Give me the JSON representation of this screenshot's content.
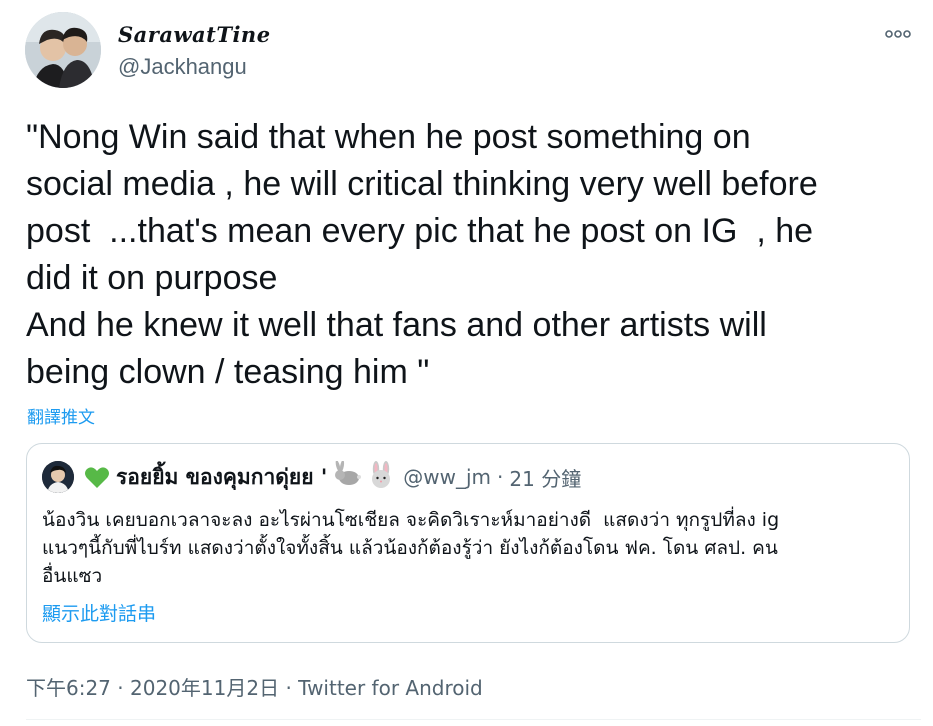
{
  "author": {
    "display_name": "SarawatTine",
    "handle": "@Jackhangu"
  },
  "tweet": {
    "text": "\"Nong Win said that when he post something on\nsocial media , he will critical thinking very well before\npost  ...that's mean every pic that he post on IG  , he\ndid it on purpose\nAnd he knew it well that fans and other artists will\nbeing clown / teasing him \"",
    "translate_label": "翻譯推文"
  },
  "quote": {
    "name": "รอยยิ้ม ของคุมกาดุ่ยย '",
    "handle": "@ww_jm",
    "separator": "·",
    "time": "21 分鐘",
    "text": "น้องวิน เคยบอกเวลาจะลง อะไรผ่านโซเชียล จะคิดวิเราะห์มาอย่างดี  แสดงว่า ทุกรูปที่ลง ig\nแนวๆนี้กับพี่ไบร์ท แสดงว่าตั้งใจทั้งสิ้น แล้วน้องก้ต้องรู้ว่า ยังไงก้ต้องโดน ฟค. โดน ศลป. คน\nอื่นแซว",
    "thread_link": "顯示此對話串",
    "heart_color": "#57b947"
  },
  "footer": {
    "time": "下午6:27",
    "separator1": "·",
    "date": "2020年11月2日",
    "separator2": "·",
    "source": "Twitter for Android"
  },
  "colors": {
    "link": "#1d9bf0",
    "secondary": "#536471",
    "border": "#cfd9de"
  }
}
